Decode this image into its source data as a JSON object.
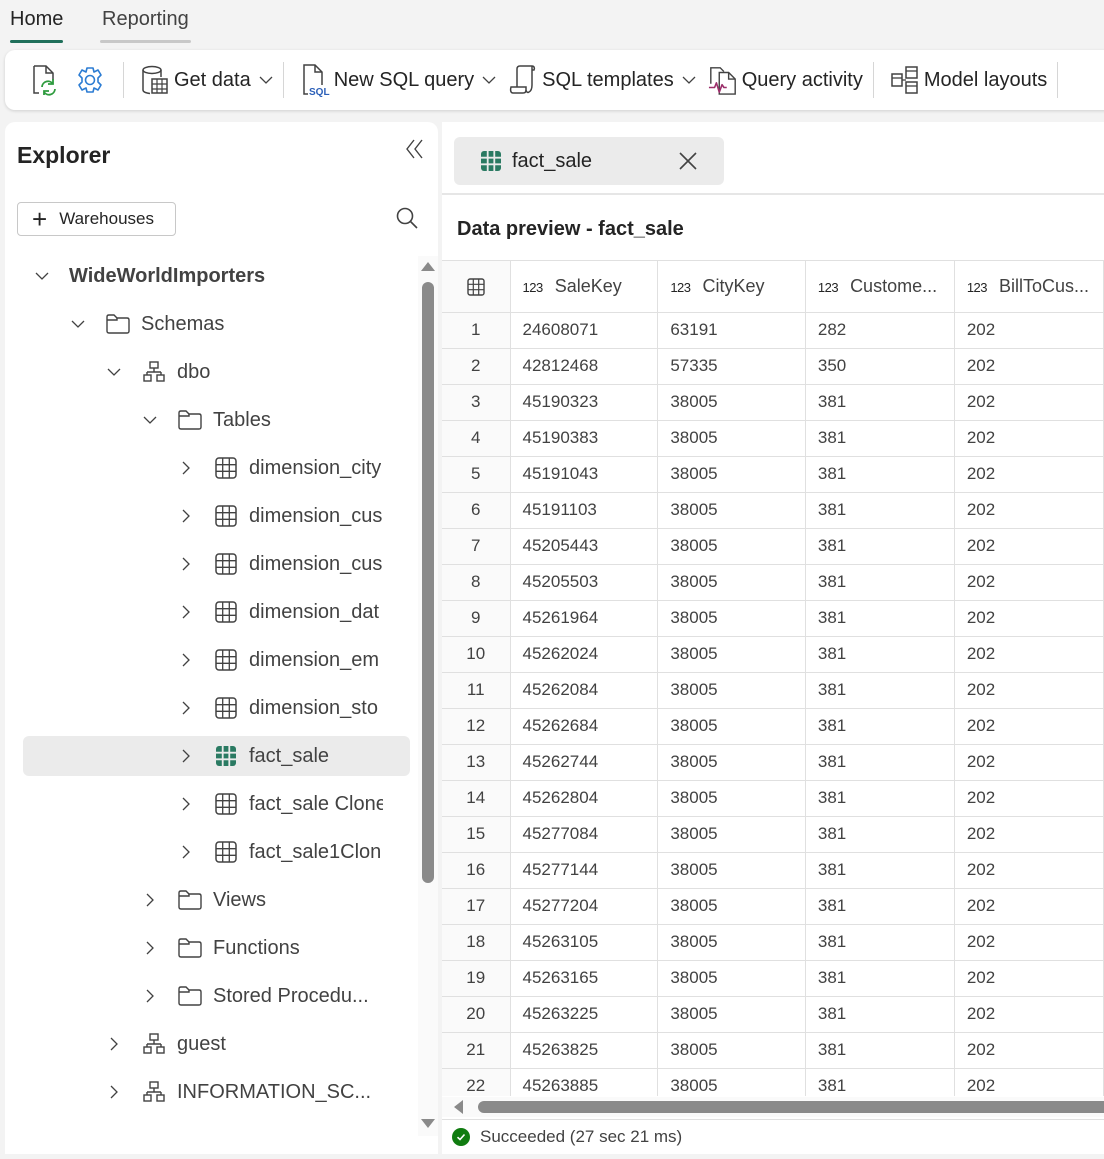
{
  "ribbon": {
    "tabs": [
      {
        "label": "Home",
        "active": true
      },
      {
        "label": "Reporting",
        "active": false
      }
    ]
  },
  "toolbar": {
    "refresh_icon": "refresh-document-icon",
    "settings_icon": "gear-icon",
    "get_data_label": "Get data",
    "new_sql_query_label": "New SQL query",
    "sql_templates_label": "SQL templates",
    "query_activity_label": "Query activity",
    "model_layouts_label": "Model layouts"
  },
  "explorer": {
    "title": "Explorer",
    "add_button_label": "Warehouses",
    "tree": [
      {
        "label": "WideWorldImporters",
        "icon": "none",
        "expanded": true,
        "level": 0
      },
      {
        "label": "Schemas",
        "icon": "folder-icon",
        "expanded": true,
        "level": 1
      },
      {
        "label": "dbo",
        "icon": "schema-icon",
        "expanded": true,
        "level": 2
      },
      {
        "label": "Tables",
        "icon": "folder-icon",
        "expanded": true,
        "level": 3
      },
      {
        "label": "dimension_city",
        "icon": "table-icon",
        "expanded": false,
        "level": 4
      },
      {
        "label": "dimension_cus",
        "icon": "table-icon",
        "expanded": false,
        "level": 4
      },
      {
        "label": "dimension_cus",
        "icon": "table-icon",
        "expanded": false,
        "level": 4
      },
      {
        "label": "dimension_dat",
        "icon": "table-icon",
        "expanded": false,
        "level": 4
      },
      {
        "label": "dimension_em",
        "icon": "table-icon",
        "expanded": false,
        "level": 4
      },
      {
        "label": "dimension_sto",
        "icon": "table-icon",
        "expanded": false,
        "level": 4
      },
      {
        "label": "fact_sale",
        "icon": "table-icon",
        "expanded": false,
        "level": 4,
        "selected": true
      },
      {
        "label": "fact_sale Clone",
        "icon": "table-icon",
        "expanded": false,
        "level": 4
      },
      {
        "label": "fact_sale1Clon",
        "icon": "table-icon",
        "expanded": false,
        "level": 4
      },
      {
        "label": "Views",
        "icon": "folder-icon",
        "expanded": false,
        "level": 3
      },
      {
        "label": "Functions",
        "icon": "folder-icon",
        "expanded": false,
        "level": 3
      },
      {
        "label": "Stored Procedu...",
        "icon": "folder-icon",
        "expanded": false,
        "level": 3
      },
      {
        "label": "guest",
        "icon": "schema-icon",
        "expanded": false,
        "level": 2
      },
      {
        "label": "INFORMATION_SC...",
        "icon": "schema-icon",
        "expanded": false,
        "level": 2
      }
    ]
  },
  "editor": {
    "tab_label": "fact_sale",
    "preview_title": "Data preview - fact_sale",
    "columns": [
      {
        "type": "123",
        "name": "SaleKey"
      },
      {
        "type": "123",
        "name": "CityKey"
      },
      {
        "type": "123",
        "name": "Custome..."
      },
      {
        "type": "123",
        "name": "BillToCus..."
      }
    ],
    "rows": [
      [
        "1",
        "24608071",
        "63191",
        "282",
        "202"
      ],
      [
        "2",
        "42812468",
        "57335",
        "350",
        "202"
      ],
      [
        "3",
        "45190323",
        "38005",
        "381",
        "202"
      ],
      [
        "4",
        "45190383",
        "38005",
        "381",
        "202"
      ],
      [
        "5",
        "45191043",
        "38005",
        "381",
        "202"
      ],
      [
        "6",
        "45191103",
        "38005",
        "381",
        "202"
      ],
      [
        "7",
        "45205443",
        "38005",
        "381",
        "202"
      ],
      [
        "8",
        "45205503",
        "38005",
        "381",
        "202"
      ],
      [
        "9",
        "45261964",
        "38005",
        "381",
        "202"
      ],
      [
        "10",
        "45262024",
        "38005",
        "381",
        "202"
      ],
      [
        "11",
        "45262084",
        "38005",
        "381",
        "202"
      ],
      [
        "12",
        "45262684",
        "38005",
        "381",
        "202"
      ],
      [
        "13",
        "45262744",
        "38005",
        "381",
        "202"
      ],
      [
        "14",
        "45262804",
        "38005",
        "381",
        "202"
      ],
      [
        "15",
        "45277084",
        "38005",
        "381",
        "202"
      ],
      [
        "16",
        "45277144",
        "38005",
        "381",
        "202"
      ],
      [
        "17",
        "45277204",
        "38005",
        "381",
        "202"
      ],
      [
        "18",
        "45263105",
        "38005",
        "381",
        "202"
      ],
      [
        "19",
        "45263165",
        "38005",
        "381",
        "202"
      ],
      [
        "20",
        "45263225",
        "38005",
        "381",
        "202"
      ],
      [
        "21",
        "45263825",
        "38005",
        "381",
        "202"
      ],
      [
        "22",
        "45263885",
        "38005",
        "381",
        "202"
      ]
    ],
    "status_text": "Succeeded (27 sec 21 ms)"
  },
  "colors": {
    "accent": "#1f6f5a",
    "selected_table_icon": "#2a7a62",
    "success": "#107c10",
    "settings_icon": "#2b7cd3"
  }
}
